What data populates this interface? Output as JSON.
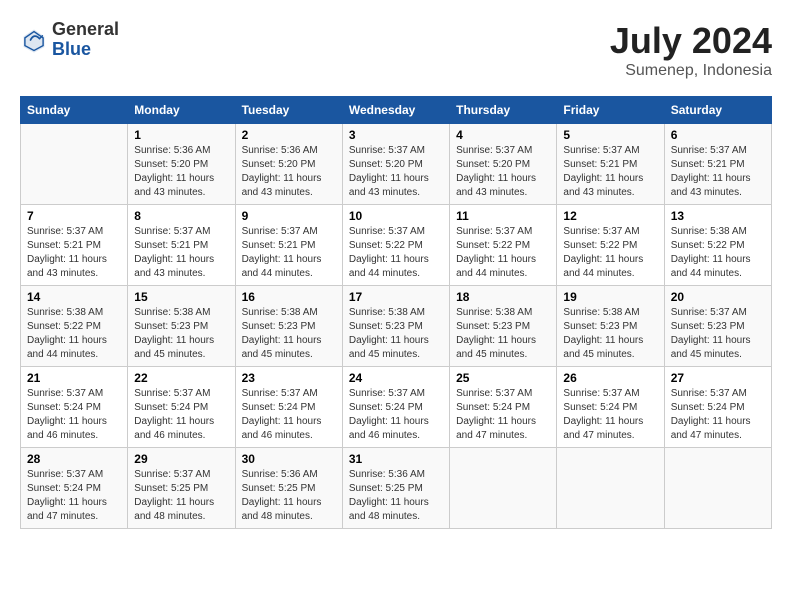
{
  "header": {
    "logo_general": "General",
    "logo_blue": "Blue",
    "month_year": "July 2024",
    "location": "Sumenep, Indonesia"
  },
  "weekdays": [
    "Sunday",
    "Monday",
    "Tuesday",
    "Wednesday",
    "Thursday",
    "Friday",
    "Saturday"
  ],
  "weeks": [
    [
      {
        "day": "",
        "info": ""
      },
      {
        "day": "1",
        "info": "Sunrise: 5:36 AM\nSunset: 5:20 PM\nDaylight: 11 hours\nand 43 minutes."
      },
      {
        "day": "2",
        "info": "Sunrise: 5:36 AM\nSunset: 5:20 PM\nDaylight: 11 hours\nand 43 minutes."
      },
      {
        "day": "3",
        "info": "Sunrise: 5:37 AM\nSunset: 5:20 PM\nDaylight: 11 hours\nand 43 minutes."
      },
      {
        "day": "4",
        "info": "Sunrise: 5:37 AM\nSunset: 5:20 PM\nDaylight: 11 hours\nand 43 minutes."
      },
      {
        "day": "5",
        "info": "Sunrise: 5:37 AM\nSunset: 5:21 PM\nDaylight: 11 hours\nand 43 minutes."
      },
      {
        "day": "6",
        "info": "Sunrise: 5:37 AM\nSunset: 5:21 PM\nDaylight: 11 hours\nand 43 minutes."
      }
    ],
    [
      {
        "day": "7",
        "info": "Sunrise: 5:37 AM\nSunset: 5:21 PM\nDaylight: 11 hours\nand 43 minutes."
      },
      {
        "day": "8",
        "info": "Sunrise: 5:37 AM\nSunset: 5:21 PM\nDaylight: 11 hours\nand 43 minutes."
      },
      {
        "day": "9",
        "info": "Sunrise: 5:37 AM\nSunset: 5:21 PM\nDaylight: 11 hours\nand 44 minutes."
      },
      {
        "day": "10",
        "info": "Sunrise: 5:37 AM\nSunset: 5:22 PM\nDaylight: 11 hours\nand 44 minutes."
      },
      {
        "day": "11",
        "info": "Sunrise: 5:37 AM\nSunset: 5:22 PM\nDaylight: 11 hours\nand 44 minutes."
      },
      {
        "day": "12",
        "info": "Sunrise: 5:37 AM\nSunset: 5:22 PM\nDaylight: 11 hours\nand 44 minutes."
      },
      {
        "day": "13",
        "info": "Sunrise: 5:38 AM\nSunset: 5:22 PM\nDaylight: 11 hours\nand 44 minutes."
      }
    ],
    [
      {
        "day": "14",
        "info": "Sunrise: 5:38 AM\nSunset: 5:22 PM\nDaylight: 11 hours\nand 44 minutes."
      },
      {
        "day": "15",
        "info": "Sunrise: 5:38 AM\nSunset: 5:23 PM\nDaylight: 11 hours\nand 45 minutes."
      },
      {
        "day": "16",
        "info": "Sunrise: 5:38 AM\nSunset: 5:23 PM\nDaylight: 11 hours\nand 45 minutes."
      },
      {
        "day": "17",
        "info": "Sunrise: 5:38 AM\nSunset: 5:23 PM\nDaylight: 11 hours\nand 45 minutes."
      },
      {
        "day": "18",
        "info": "Sunrise: 5:38 AM\nSunset: 5:23 PM\nDaylight: 11 hours\nand 45 minutes."
      },
      {
        "day": "19",
        "info": "Sunrise: 5:38 AM\nSunset: 5:23 PM\nDaylight: 11 hours\nand 45 minutes."
      },
      {
        "day": "20",
        "info": "Sunrise: 5:37 AM\nSunset: 5:23 PM\nDaylight: 11 hours\nand 45 minutes."
      }
    ],
    [
      {
        "day": "21",
        "info": "Sunrise: 5:37 AM\nSunset: 5:24 PM\nDaylight: 11 hours\nand 46 minutes."
      },
      {
        "day": "22",
        "info": "Sunrise: 5:37 AM\nSunset: 5:24 PM\nDaylight: 11 hours\nand 46 minutes."
      },
      {
        "day": "23",
        "info": "Sunrise: 5:37 AM\nSunset: 5:24 PM\nDaylight: 11 hours\nand 46 minutes."
      },
      {
        "day": "24",
        "info": "Sunrise: 5:37 AM\nSunset: 5:24 PM\nDaylight: 11 hours\nand 46 minutes."
      },
      {
        "day": "25",
        "info": "Sunrise: 5:37 AM\nSunset: 5:24 PM\nDaylight: 11 hours\nand 47 minutes."
      },
      {
        "day": "26",
        "info": "Sunrise: 5:37 AM\nSunset: 5:24 PM\nDaylight: 11 hours\nand 47 minutes."
      },
      {
        "day": "27",
        "info": "Sunrise: 5:37 AM\nSunset: 5:24 PM\nDaylight: 11 hours\nand 47 minutes."
      }
    ],
    [
      {
        "day": "28",
        "info": "Sunrise: 5:37 AM\nSunset: 5:24 PM\nDaylight: 11 hours\nand 47 minutes."
      },
      {
        "day": "29",
        "info": "Sunrise: 5:37 AM\nSunset: 5:25 PM\nDaylight: 11 hours\nand 48 minutes."
      },
      {
        "day": "30",
        "info": "Sunrise: 5:36 AM\nSunset: 5:25 PM\nDaylight: 11 hours\nand 48 minutes."
      },
      {
        "day": "31",
        "info": "Sunrise: 5:36 AM\nSunset: 5:25 PM\nDaylight: 11 hours\nand 48 minutes."
      },
      {
        "day": "",
        "info": ""
      },
      {
        "day": "",
        "info": ""
      },
      {
        "day": "",
        "info": ""
      }
    ]
  ]
}
